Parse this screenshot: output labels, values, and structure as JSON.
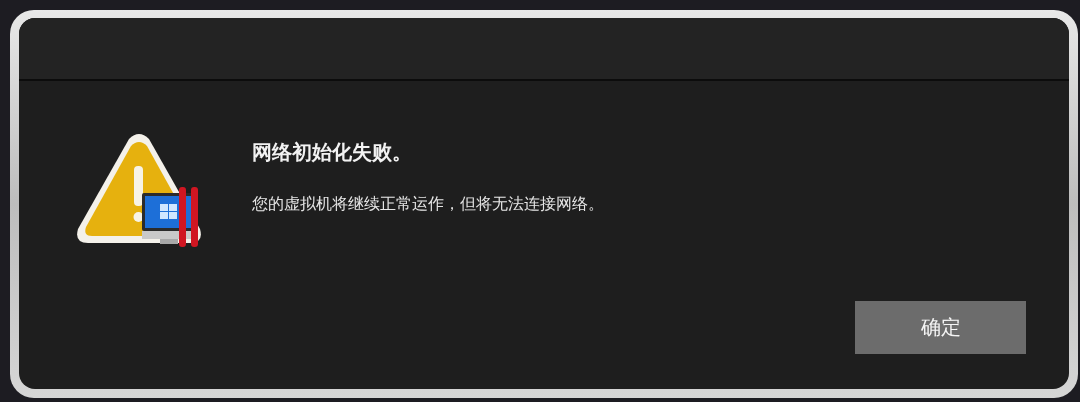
{
  "dialog": {
    "title": "网络初始化失败。",
    "message": "您的虚拟机将继续正常运作，但将无法连接网络。",
    "buttons": [
      {
        "label": "确定",
        "selected": true
      }
    ]
  }
}
